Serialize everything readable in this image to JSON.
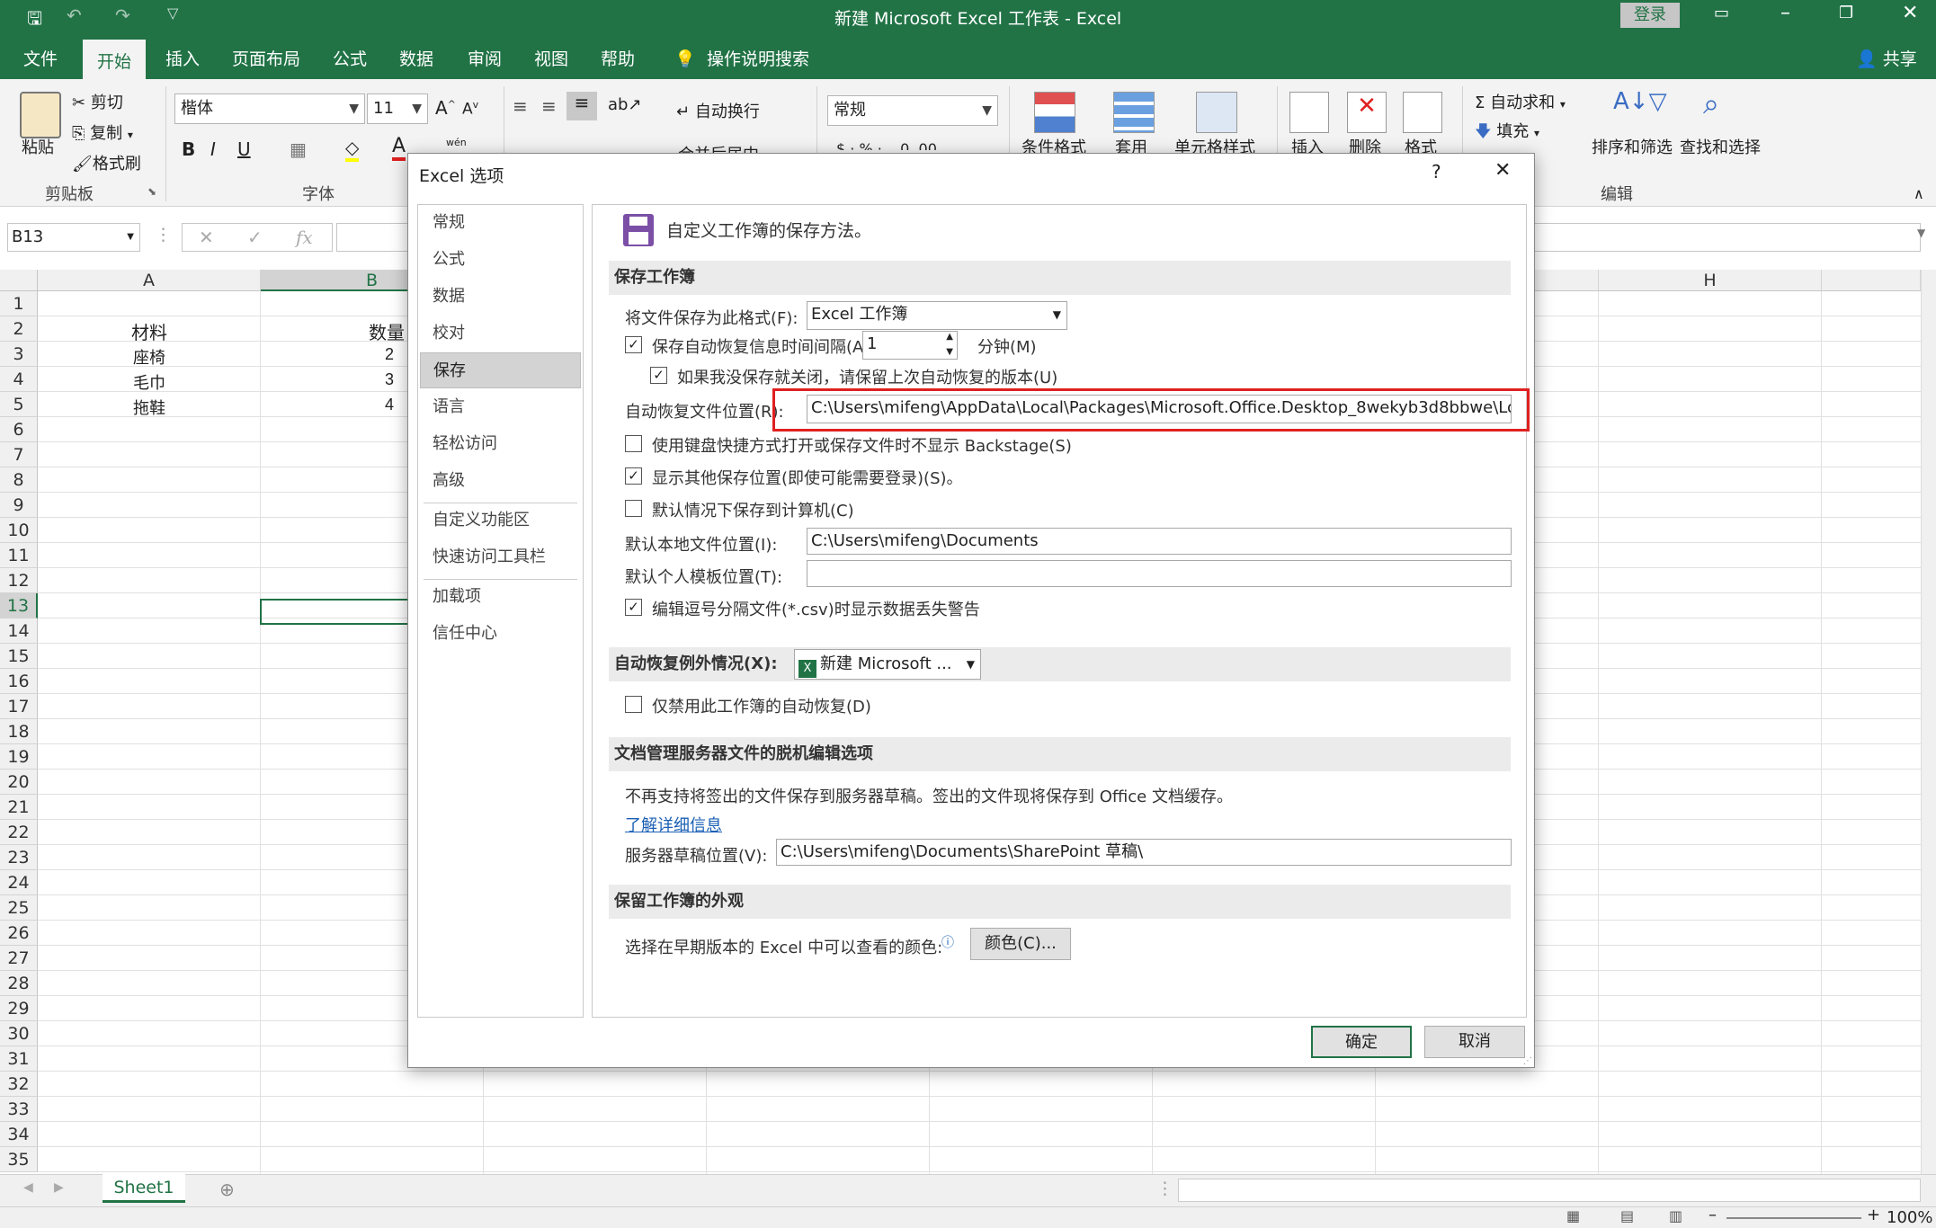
{
  "window": {
    "title": "新建 Microsoft Excel 工作表  -  Excel",
    "login": "登录"
  },
  "tabs": [
    "文件",
    "开始",
    "插入",
    "页面布局",
    "公式",
    "数据",
    "审阅",
    "视图",
    "帮助"
  ],
  "tell_me": "操作说明搜索",
  "share": "共享",
  "ribbon": {
    "clipboard": {
      "paste": "粘贴",
      "cut": "剪切",
      "copy": "复制",
      "format_painter": "格式刷",
      "group": "剪贴板"
    },
    "font": {
      "name": "楷体",
      "size": "11",
      "group": "字体",
      "wen": "wén"
    },
    "alignment": {
      "wrap": "自动换行",
      "merge": "合并后居中"
    },
    "number": {
      "format": "常规"
    },
    "styles": {
      "cond": "条件格式",
      "table": "套用",
      "cell": "单元格样式"
    },
    "cells": {
      "insert": "插入",
      "delete": "删除",
      "format": "格式"
    },
    "editing": {
      "autosum": "自动求和",
      "fill": "填充",
      "sort": "排序和筛选",
      "find": "查找和选择",
      "group": "编辑"
    }
  },
  "formula_bar": {
    "namebox": "B13",
    "fx": "fx"
  },
  "columns": [
    "A",
    "B",
    "H"
  ],
  "rows": [
    "1",
    "2",
    "3",
    "4",
    "5",
    "6",
    "7",
    "8",
    "9",
    "10",
    "11",
    "12",
    "13",
    "14",
    "15",
    "16",
    "17",
    "18",
    "19",
    "20",
    "21",
    "22",
    "23",
    "24",
    "25",
    "26",
    "27",
    "28",
    "29",
    "30",
    "31",
    "32",
    "33",
    "34",
    "35"
  ],
  "cells": {
    "a2": "材料",
    "b2": "数量",
    "a3": "座椅",
    "b3": "2",
    "a4": "毛巾",
    "b4": "3",
    "a5": "拖鞋",
    "b5": "4"
  },
  "sheet": {
    "name": "Sheet1"
  },
  "status": {
    "zoom": "100%"
  },
  "dialog": {
    "title": "Excel 选项",
    "help": "?",
    "close": "✕",
    "nav": [
      "常规",
      "公式",
      "数据",
      "校对",
      "保存",
      "语言",
      "轻松访问",
      "高级",
      "自定义功能区",
      "快速访问工具栏",
      "加载项",
      "信任中心"
    ],
    "header": "自定义工作簿的保存方法。",
    "sec_save": "保存工作簿",
    "save_format_label": "将文件保存为此格式(F):",
    "save_format_value": "Excel 工作簿",
    "autorecover_label": "保存自动恢复信息时间间隔(A)",
    "autorecover_minutes": "1",
    "minutes_label": "分钟(M)",
    "keep_last_label": "如果我没保存就关闭，请保留上次自动恢复的版本(U)",
    "ar_location_label": "自动恢复文件位置(R):",
    "ar_location_value": "C:\\Users\\mifeng\\AppData\\Local\\Packages\\Microsoft.Office.Desktop_8wekyb3d8bbwe\\LocalCache\\Roaming\\Microsoft\\Excel\\",
    "no_backstage_label": "使用键盘快捷方式打开或保存文件时不显示 Backstage(S)",
    "show_more_label": "显示其他保存位置(即使可能需要登录)(S)。",
    "save_computer_label": "默认情况下保存到计算机(C)",
    "default_local_label": "默认本地文件位置(I):",
    "default_local_value": "C:\\Users\\mifeng\\Documents",
    "template_label": "默认个人模板位置(T):",
    "template_value": "",
    "csv_warn_label": "编辑逗号分隔文件(*.csv)时显示数据丢失警告",
    "sec_exceptions": "自动恢复例外情况(X):",
    "exception_book": "新建 Microsoft ...",
    "disable_ar_label": "仅禁用此工作簿的自动恢复(D)",
    "sec_offline": "文档管理服务器文件的脱机编辑选项",
    "offline_note": "不再支持将签出的文件保存到服务器草稿。签出的文件现将保存到 Office 文档缓存。",
    "learn_more": "了解详细信息",
    "server_drafts_label": "服务器草稿位置(V):",
    "server_drafts_value": "C:\\Users\\mifeng\\Documents\\SharePoint 草稿\\",
    "sec_appearance": "保留工作簿的外观",
    "colors_label": "选择在早期版本的 Excel 中可以查看的颜色:",
    "colors_button": "颜色(C)...",
    "ok": "确定",
    "cancel": "取消"
  },
  "colors": {
    "excel_green": "#217346",
    "highlight_red": "#e02020"
  }
}
